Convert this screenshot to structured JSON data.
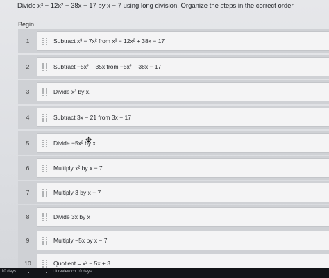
{
  "question": "Divide x³ − 12x² + 38x − 17 by x − 7 using long division. Organize the steps in the correct order.",
  "begin_label": "Begin",
  "steps": [
    {
      "number": "1",
      "text": "Subtract x³ − 7x² from x³ − 12x² + 38x − 17"
    },
    {
      "number": "2",
      "text": "Subtract −5x² + 35x from −5x² + 38x − 17"
    },
    {
      "number": "3",
      "text": "Divide x³ by x."
    },
    {
      "number": "4",
      "text": "Subtract 3x − 21 from 3x − 17"
    },
    {
      "number": "5",
      "text": "Divide −5x² by x"
    },
    {
      "number": "6",
      "text": "Multiply x² by x − 7"
    },
    {
      "number": "7",
      "text": "Multiply 3 by x − 7"
    },
    {
      "number": "8",
      "text": "Divide 3x by x"
    },
    {
      "number": "9",
      "text": "Multiply −5x by x − 7"
    },
    {
      "number": "10",
      "text": "Quotient = x² − 5x + 3"
    }
  ],
  "taskbar": {
    "left_text": "10 days",
    "mid_text": "Lit review ch 10 days"
  },
  "icons": {
    "drag_handle": "drag-handle-icon",
    "cursor": "move-cursor-icon"
  }
}
